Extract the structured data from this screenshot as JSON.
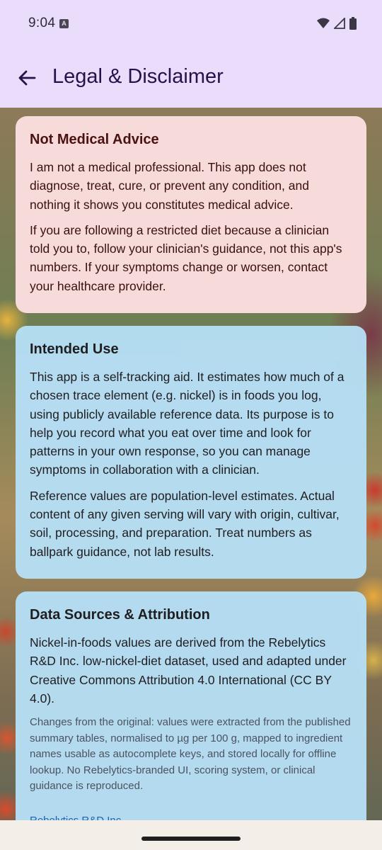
{
  "status_bar": {
    "time": "9:04",
    "notification_icon": "a-letter-icon",
    "icons": [
      "wifi-icon",
      "signal-icon",
      "battery-icon"
    ]
  },
  "app_bar": {
    "back_icon": "arrow-left-icon",
    "title": "Legal & Disclaimer",
    "background": "#eadcfb",
    "title_color": "#24124a"
  },
  "cards": {
    "medical": {
      "title": "Not Medical Advice",
      "paragraphs": [
        "I am not a medical professional. This app does not diagnose, treat, cure, or prevent any condition, and nothing it shows you constitutes medical advice.",
        "If you are following a restricted diet because a clinician told you to, follow your clinician's guidance, not this app's numbers. If your symptoms change or worsen, contact your healthcare provider."
      ],
      "color": "#f7dada"
    },
    "intended_use": {
      "title": "Intended Use",
      "paragraphs": [
        "This app is a self-tracking aid. It estimates how much of a chosen trace element (e.g. nickel) is in foods you log, using publicly available reference data. Its purpose is to help you record what you eat over time and look for patterns in your own response, so you can manage symptoms in collaboration with a clinician.",
        "Reference values are population-level estimates. Actual content of any given serving will vary with origin, cultivar, soil, processing, and preparation. Treat numbers as ballpark guidance, not lab results."
      ],
      "color": "#b6def4"
    },
    "data_sources": {
      "title": "Data Sources & Attribution",
      "paragraph": "Nickel-in-foods values are derived from the Rebelytics R&D Inc. low-nickel-diet dataset, used and adapted under Creative Commons Attribution 4.0 International (CC BY 4.0).",
      "note": "Changes from the original: values were extracted from the published summary tables, normalised to µg per 100 g, mapped to ingredient names usable as autocomplete keys, and stored locally for offline lookup. No Rebelytics-branded UI, scoring system, or clinical guidance is reproduced.",
      "link": "Rebelytics R&D Inc.",
      "link_color": "#1f63b4"
    }
  }
}
